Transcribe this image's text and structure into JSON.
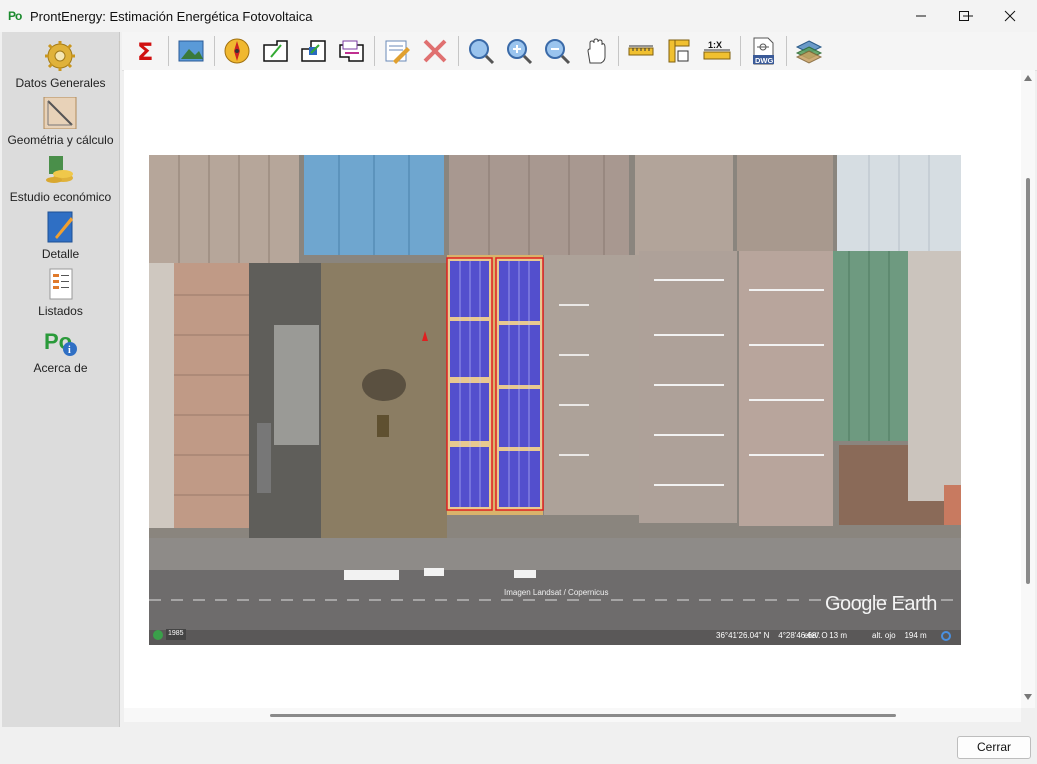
{
  "window": {
    "title": "ProntEnergy: Estimación Energética Fotovoltaica",
    "app_badge": "Po"
  },
  "sidebar": {
    "items": [
      {
        "label": "Datos Generales",
        "icon": "gear-icon"
      },
      {
        "label": "Geométria y cálculo",
        "icon": "geometry-icon"
      },
      {
        "label": "Estudio económico",
        "icon": "money-icon"
      },
      {
        "label": "Detalle",
        "icon": "detail-icon"
      },
      {
        "label": "Listados",
        "icon": "list-icon"
      },
      {
        "label": "Acerca de",
        "icon": "about-icon"
      }
    ]
  },
  "toolbar": {
    "zoom_scale_label": "1:X",
    "dwg_label": "DWG"
  },
  "map": {
    "attribution": "Imagen Landsat / Copernicus",
    "brand": "Google Earth",
    "year": "1985",
    "coordinates": "36°41'26.04\" N    4°28'46.68\" O",
    "elevation": "elev.    13 m",
    "eye_altitude": "alt. ojo    194 m"
  },
  "footer": {
    "close_label": "Cerrar"
  }
}
